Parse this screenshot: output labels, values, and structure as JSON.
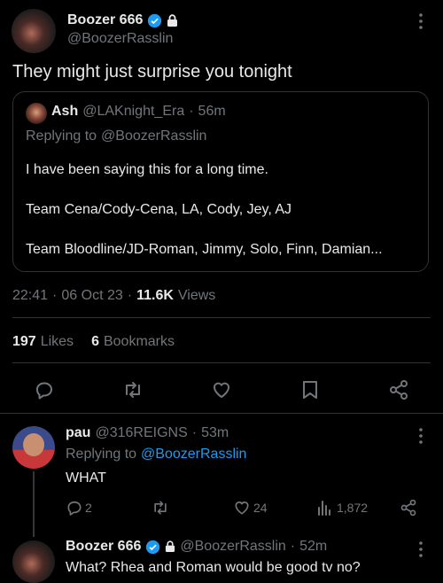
{
  "main_tweet": {
    "author_name": "Boozer 666",
    "handle": "@BoozerRasslin",
    "text": "They might just surprise you tonight",
    "time": "22:41",
    "date": "06 Oct 23",
    "views_count": "11.6K",
    "views_label": "Views",
    "likes_count": "197",
    "likes_label": "Likes",
    "bookmarks_count": "6",
    "bookmarks_label": "Bookmarks"
  },
  "quoted": {
    "author_name": "Ash",
    "handle": "@LAKnight_Era",
    "age": "56m",
    "replying_label": "Replying to",
    "replying_to": "@BoozerRasslin",
    "line1": "I have been saying this for a long time.",
    "line2": "Team Cena/Cody-Cena, LA, Cody, Jey, AJ",
    "line3": "Team Bloodline/JD-Roman, Jimmy, Solo, Finn, Damian..."
  },
  "reply1": {
    "author_name": "pau",
    "handle": "@316REIGNS",
    "age": "53m",
    "replying_label": "Replying to",
    "replying_to": "@BoozerRasslin",
    "text": "WHAT",
    "replies": "2",
    "reposts": "",
    "likes": "24",
    "views": "1,872"
  },
  "reply2": {
    "author_name": "Boozer 666",
    "handle": "@BoozerRasslin",
    "age": "52m",
    "text": "What? Rhea and Roman would be good tv no?"
  },
  "separator": "·",
  "colors": {
    "background": "#000000",
    "text": "#e7e9ea",
    "muted": "#71767b",
    "accent": "#1d9bf0",
    "border": "#2f3336"
  }
}
